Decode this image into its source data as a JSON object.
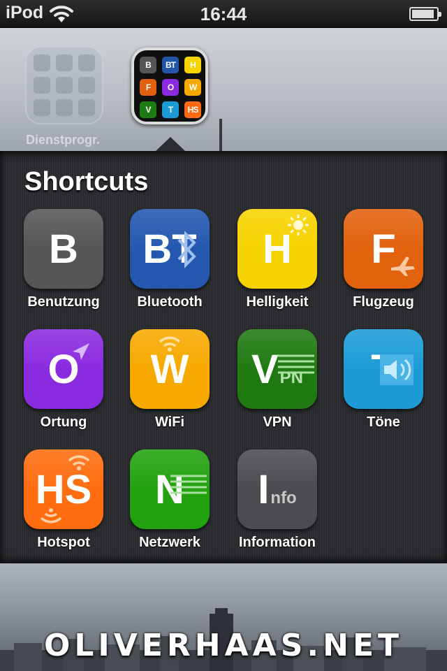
{
  "status_bar": {
    "carrier": "iPod",
    "time": "16:44",
    "battery_level": 0.9
  },
  "home": {
    "folders": [
      {
        "label": "Dienstprogr."
      }
    ],
    "active_folder_previews": [
      {
        "text": "B",
        "color": "#555555"
      },
      {
        "text": "BT",
        "color": "#2255aa"
      },
      {
        "text": "H",
        "color": "#f5d400"
      },
      {
        "text": "F",
        "color": "#e06010"
      },
      {
        "text": "O",
        "color": "#8a2be2"
      },
      {
        "text": "W",
        "color": "#f5a800"
      },
      {
        "text": "V",
        "color": "#1e7a12"
      },
      {
        "text": "T",
        "color": "#1b9ad6"
      },
      {
        "text": "HS",
        "color": "#ff6a10"
      }
    ]
  },
  "folder": {
    "title": "Shortcuts",
    "apps": [
      {
        "glyph": "B",
        "sub": "",
        "label": "Benutzung",
        "color": "#555658",
        "icon": "none"
      },
      {
        "glyph": "BT",
        "sub": "",
        "label": "Bluetooth",
        "color": "#2458b0",
        "icon": "bluetooth-icon"
      },
      {
        "glyph": "H",
        "sub": "",
        "label": "Helligkeit",
        "color": "#f6d300",
        "icon": "sun-icon"
      },
      {
        "glyph": "F",
        "sub": "",
        "label": "Flugzeug",
        "color": "#e2620e",
        "icon": "airplane-icon"
      },
      {
        "glyph": "O",
        "sub": "",
        "label": "Ortung",
        "color": "#8b2be0",
        "icon": "location-arrow-icon"
      },
      {
        "glyph": "W",
        "sub": "",
        "label": "WiFi",
        "color": "#f7a900",
        "icon": "wifi-icon"
      },
      {
        "glyph": "V",
        "sub": "PN",
        "label": "VPN",
        "color": "#1f7a12",
        "icon": "lines-icon"
      },
      {
        "glyph": "T",
        "sub": "",
        "label": "Töne",
        "color": "#1c9bd7",
        "icon": "speaker-icon"
      },
      {
        "glyph": "HS",
        "sub": "",
        "label": "Hotspot",
        "color": "#ff6d10",
        "icon": "hotspot-icon"
      },
      {
        "glyph": "N",
        "sub": "",
        "label": "Netzwerk",
        "color": "#23a20f",
        "icon": "lines-icon"
      },
      {
        "glyph": "I",
        "sub": "nfo",
        "label": "Information",
        "color": "#4b4c4f",
        "icon": "none"
      }
    ]
  },
  "watermark": "OLIVERHAAS.NET"
}
